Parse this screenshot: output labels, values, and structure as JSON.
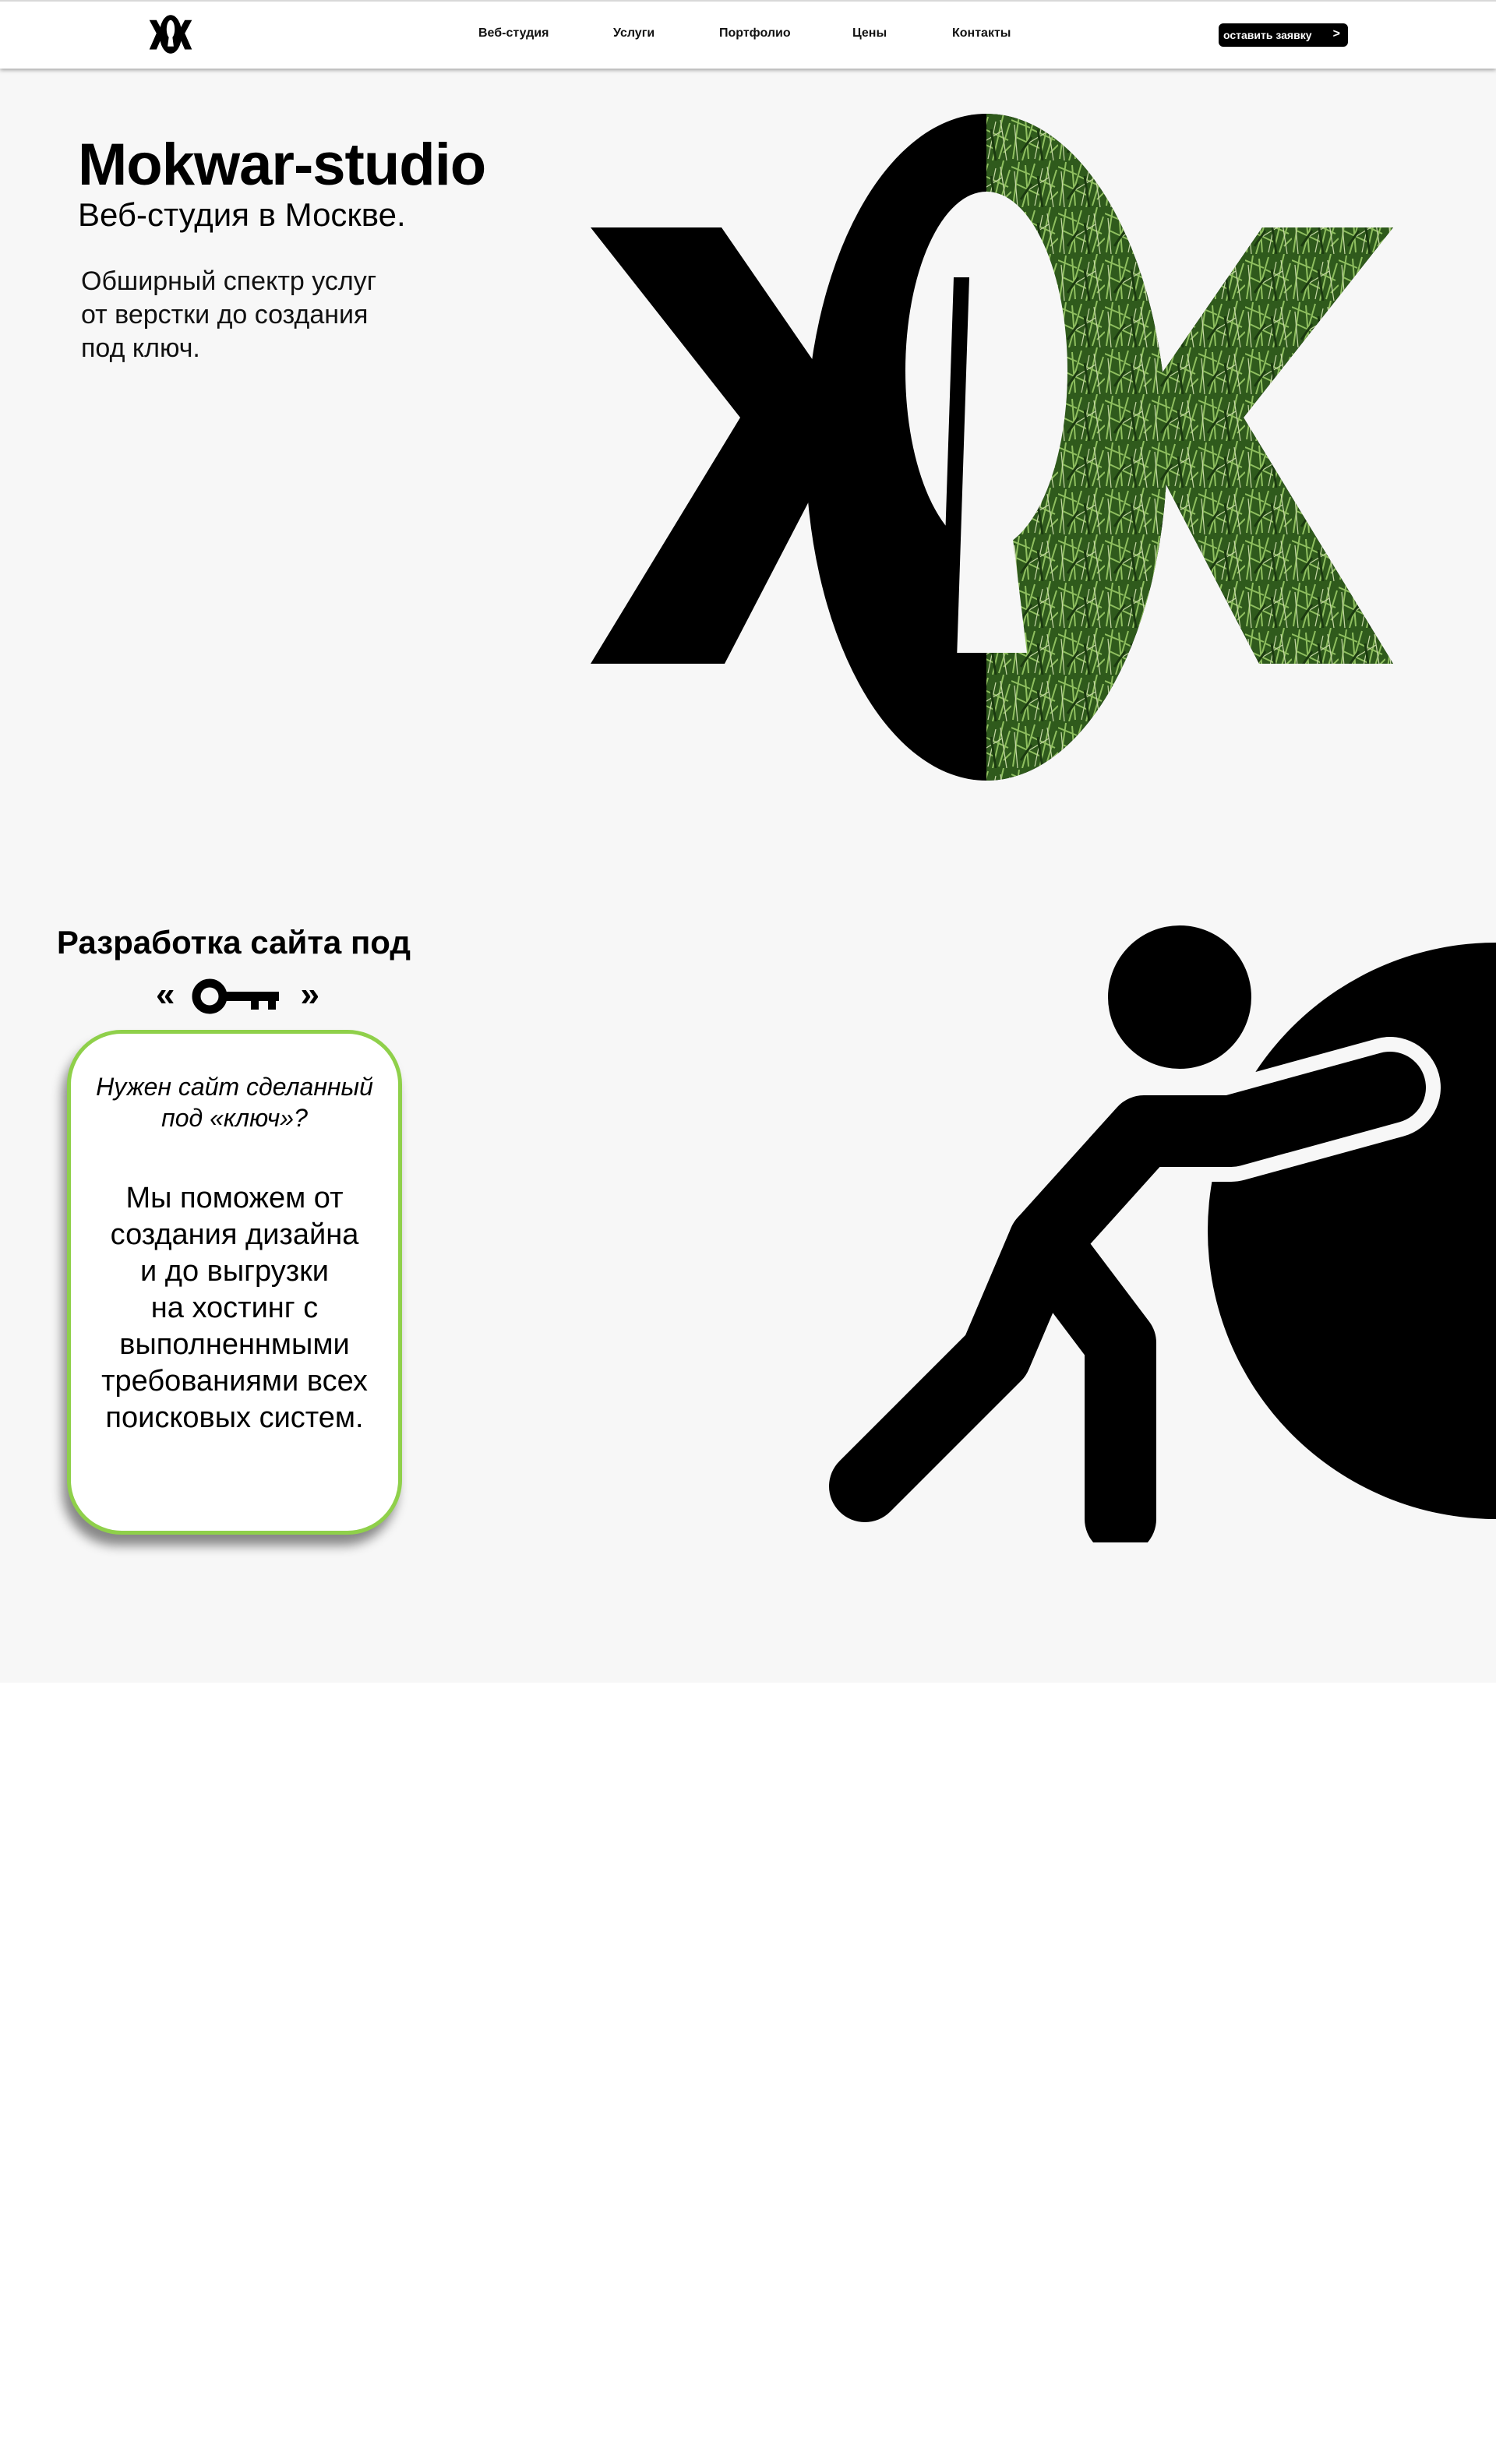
{
  "header": {
    "nav": [
      "Веб-студия",
      "Услуги",
      "Портфолио",
      "Цены",
      "Контакты"
    ],
    "cta_label": "оставить заявку",
    "cta_arrow": ">"
  },
  "hero": {
    "title": "Mokwar-studio",
    "subtitle": "Веб-студия в Москве.",
    "description_lines": [
      "Обширный спектр услуг",
      "от верстки до создания",
      "под ключ."
    ]
  },
  "section": {
    "title": "Разработка сайта под",
    "quote_open": "«",
    "quote_close": "»"
  },
  "card": {
    "question_lines": [
      "Нужен сайт сделанный",
      "под «ключ»?"
    ],
    "body_lines": [
      "Мы поможем от",
      "создания дизайна",
      "и до выгрузки",
      "на хостинг с",
      "выполненнмыми",
      "требованиями всех",
      "поисковых систем."
    ]
  },
  "colors": {
    "card_border": "#8fd04a",
    "panel_background": "#f7f7f7",
    "grass": "#3f6b25"
  },
  "icons": {
    "logo": "mokwar-logo-icon",
    "key": "key-icon",
    "illustration": "person-pushing-ball-icon"
  }
}
